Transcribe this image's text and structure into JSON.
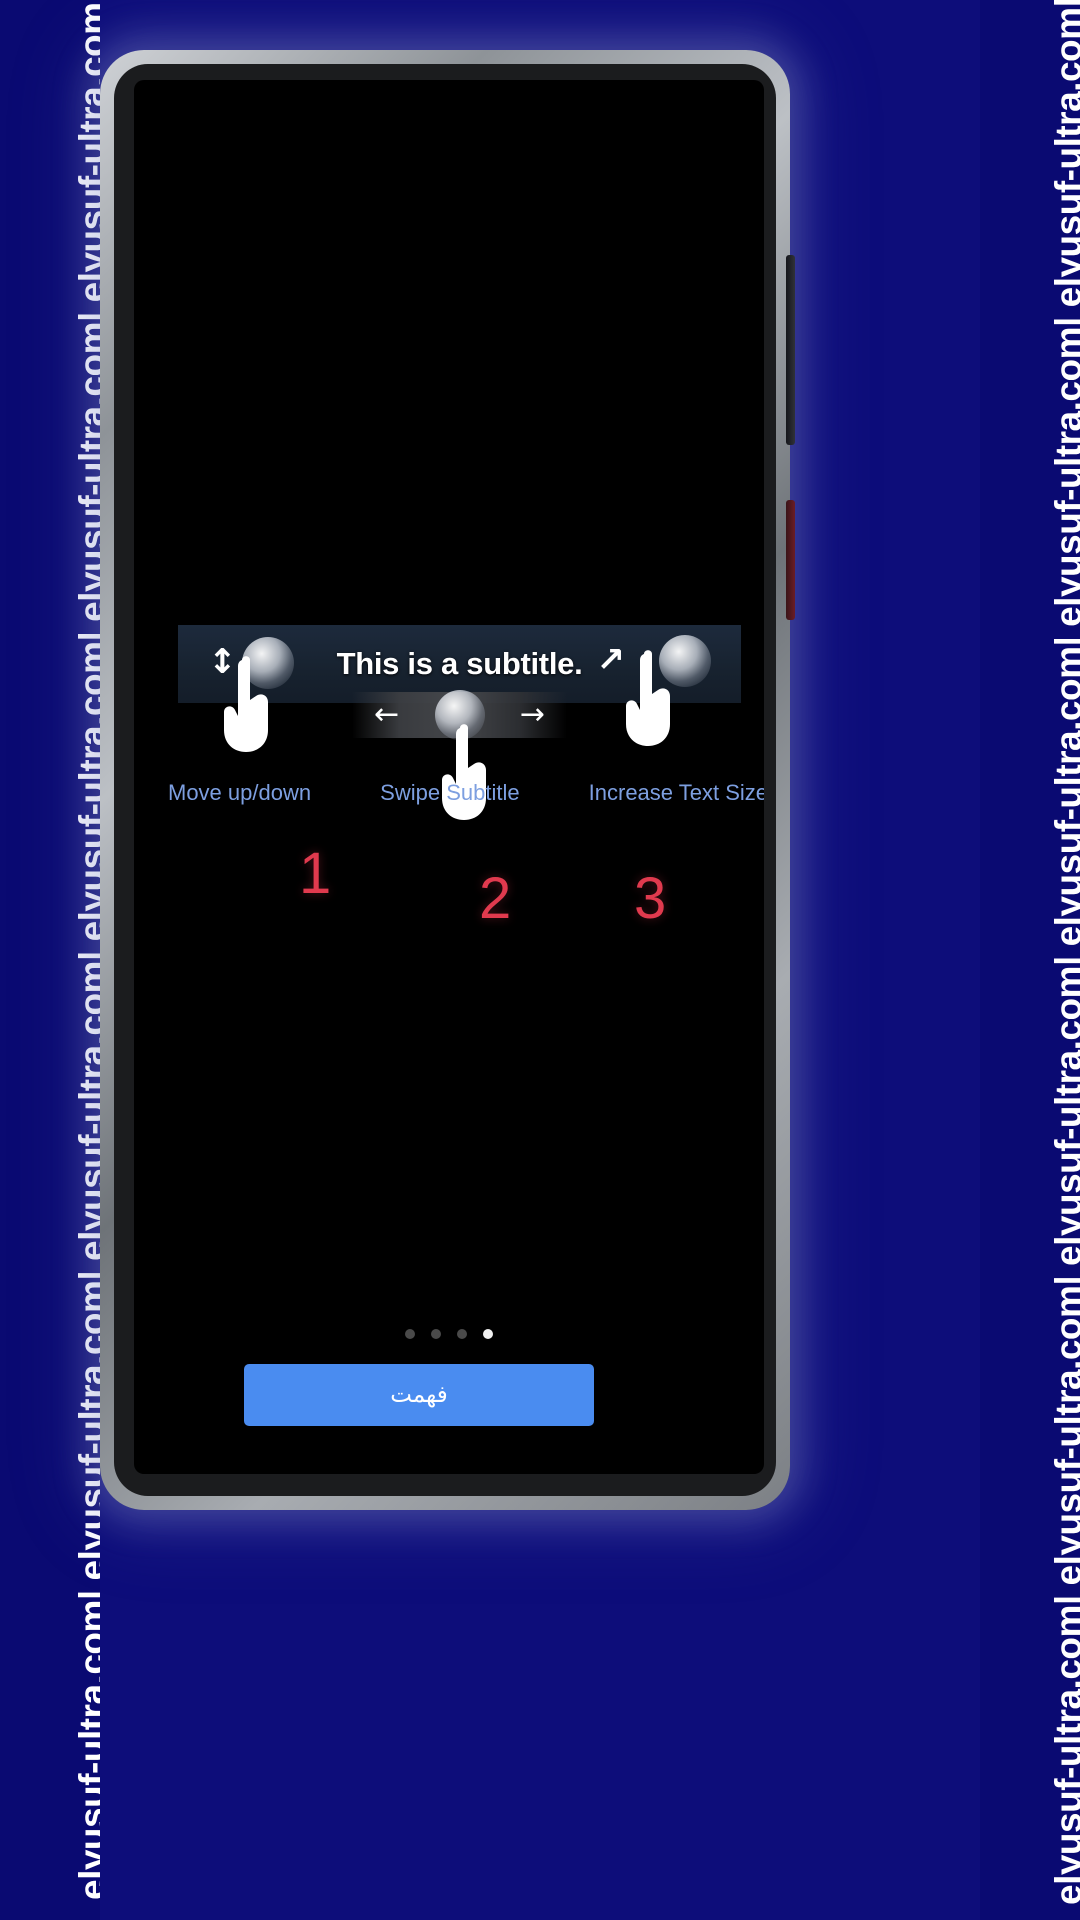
{
  "watermark": {
    "text": "elyusuf-ultra.com| elyusuf-ultra.com| elyusuf-ultra.com| elyusuf-ultra.com| elyusuf-ultra.com| elyusuf-ultra.com|"
  },
  "colors": {
    "background": "#0d0d7a",
    "screen": "#000000",
    "subtitle_band": "#1d2a3c",
    "caption_blue": "#7d9fe0",
    "step_red": "#e03a4e",
    "cta_blue": "#4a8cf0",
    "dot_active": "#f0f0f0",
    "dot_inactive": "#4a4a4a"
  },
  "overlay": {
    "subtitle_sample": "This is a subtitle.",
    "swipe_left_arrow": "←",
    "swipe_right_arrow": "→",
    "updown_glyph": "↕",
    "expand_glyph": "↗",
    "icons": {
      "move_updown": "up-down-arrow-icon",
      "swipe": "left-right-arrow-icon",
      "resize": "diagonal-expand-arrow-icon",
      "hand": "hand-pointer-icon"
    }
  },
  "captions": [
    {
      "label": "Move up/down",
      "step": "1"
    },
    {
      "label": "Swipe Subtitle",
      "step": "2"
    },
    {
      "label": "Increase Text Size",
      "step": "3"
    }
  ],
  "steps": {
    "one": "1",
    "two": "2",
    "three": "3"
  },
  "pagination": {
    "total": 4,
    "active_index": 3
  },
  "cta": {
    "label": "فهمت"
  }
}
